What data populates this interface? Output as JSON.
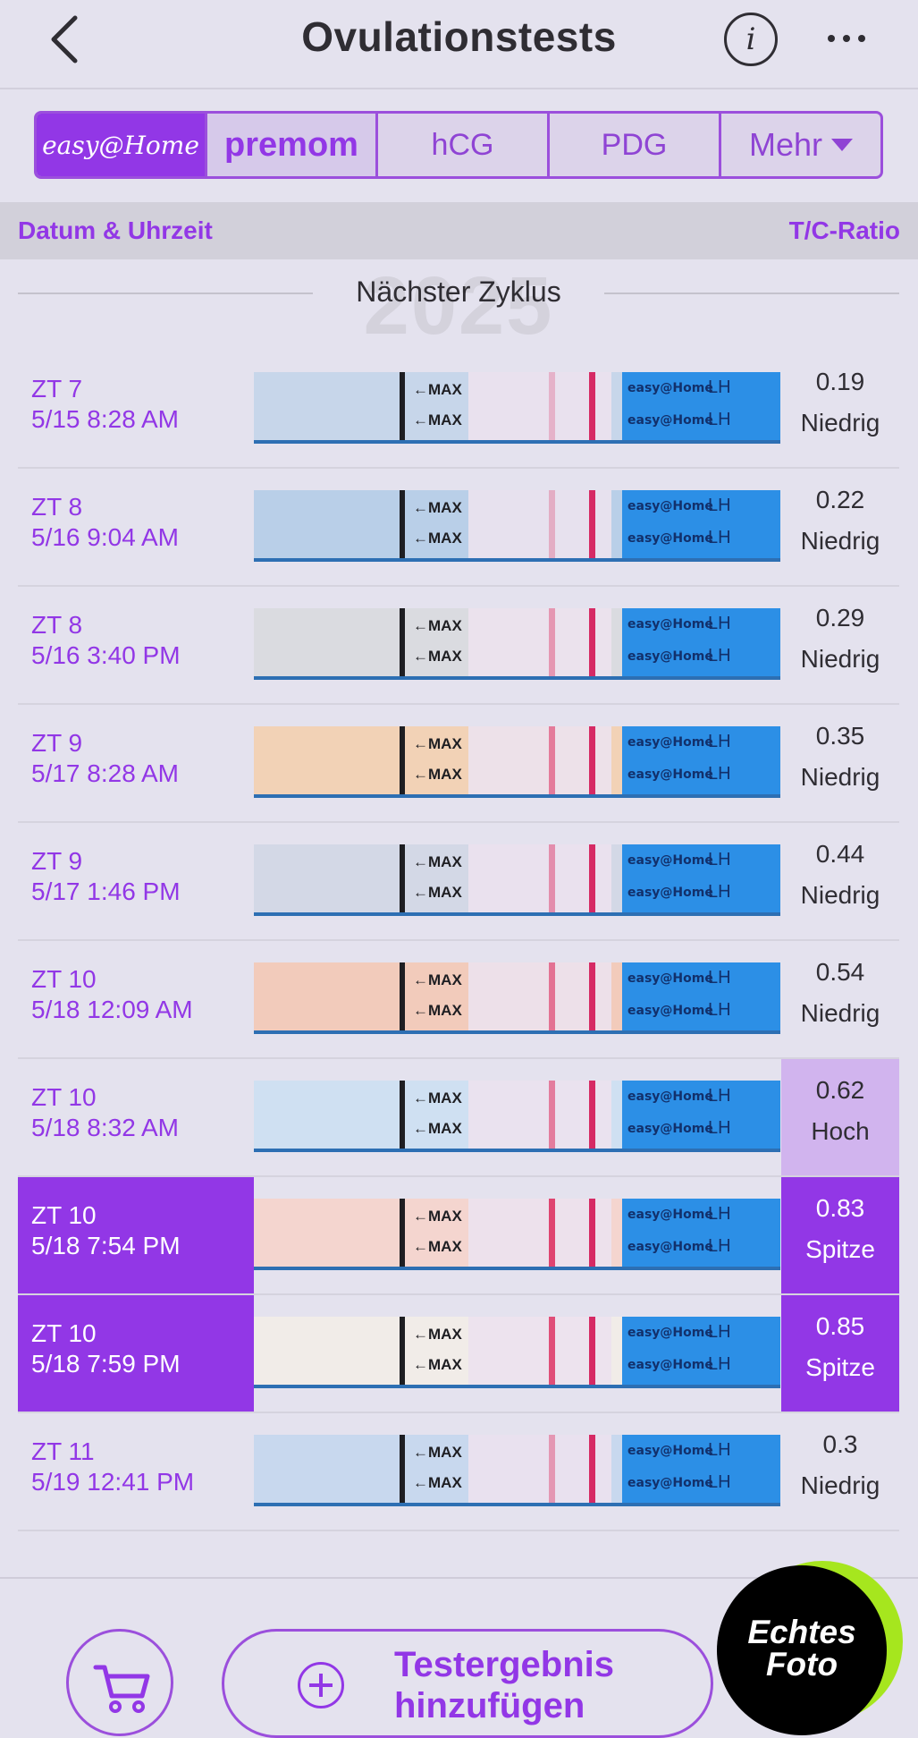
{
  "header": {
    "title": "Ovulationstests",
    "info_glyph": "i"
  },
  "tabs": [
    {
      "label": "easy@Home",
      "active": true
    },
    {
      "label": "premom",
      "active": false
    },
    {
      "label": "hCG",
      "active": false
    },
    {
      "label": "PDG",
      "active": false
    },
    {
      "label": "Mehr",
      "active": false
    }
  ],
  "columns": {
    "left": "Datum & Uhrzeit",
    "right": "T/C-Ratio"
  },
  "cycle": {
    "year_watermark": "2025",
    "label": "Nächster Zyklus"
  },
  "strip": {
    "max_label": "←MAX",
    "brand_text": "easy@Home",
    "lh_text": "LH"
  },
  "tests": [
    {
      "day": "ZT 7",
      "time": "5/15 8:28 AM",
      "ratio": "0.19",
      "level": "Niedrig",
      "state": "low"
    },
    {
      "day": "ZT 8",
      "time": "5/16 9:04 AM",
      "ratio": "0.22",
      "level": "Niedrig",
      "state": "low"
    },
    {
      "day": "ZT 8",
      "time": "5/16 3:40 PM",
      "ratio": "0.29",
      "level": "Niedrig",
      "state": "low"
    },
    {
      "day": "ZT 9",
      "time": "5/17 8:28 AM",
      "ratio": "0.35",
      "level": "Niedrig",
      "state": "low"
    },
    {
      "day": "ZT 9",
      "time": "5/17 1:46 PM",
      "ratio": "0.44",
      "level": "Niedrig",
      "state": "low"
    },
    {
      "day": "ZT 10",
      "time": "5/18 12:09 AM",
      "ratio": "0.54",
      "level": "Niedrig",
      "state": "low"
    },
    {
      "day": "ZT 10",
      "time": "5/18 8:32 AM",
      "ratio": "0.62",
      "level": "Hoch",
      "state": "high"
    },
    {
      "day": "ZT 10",
      "time": "5/18 7:54 PM",
      "ratio": "0.83",
      "level": "Spitze",
      "state": "peak"
    },
    {
      "day": "ZT 10",
      "time": "5/18 7:59 PM",
      "ratio": "0.85",
      "level": "Spitze",
      "state": "peak"
    },
    {
      "day": "ZT 11",
      "time": "5/19 12:41 PM",
      "ratio": "0.3",
      "level": "Niedrig",
      "state": "low"
    }
  ],
  "bottom": {
    "add_label_line1": "Testergebnis",
    "add_label_line2": "hinzufügen",
    "badge_line1": "Echtes",
    "badge_line2": "Foto"
  },
  "colors": {
    "accent": "#9237e6",
    "high_bg": "#d1b4ee",
    "background": "#e4e2ee"
  }
}
